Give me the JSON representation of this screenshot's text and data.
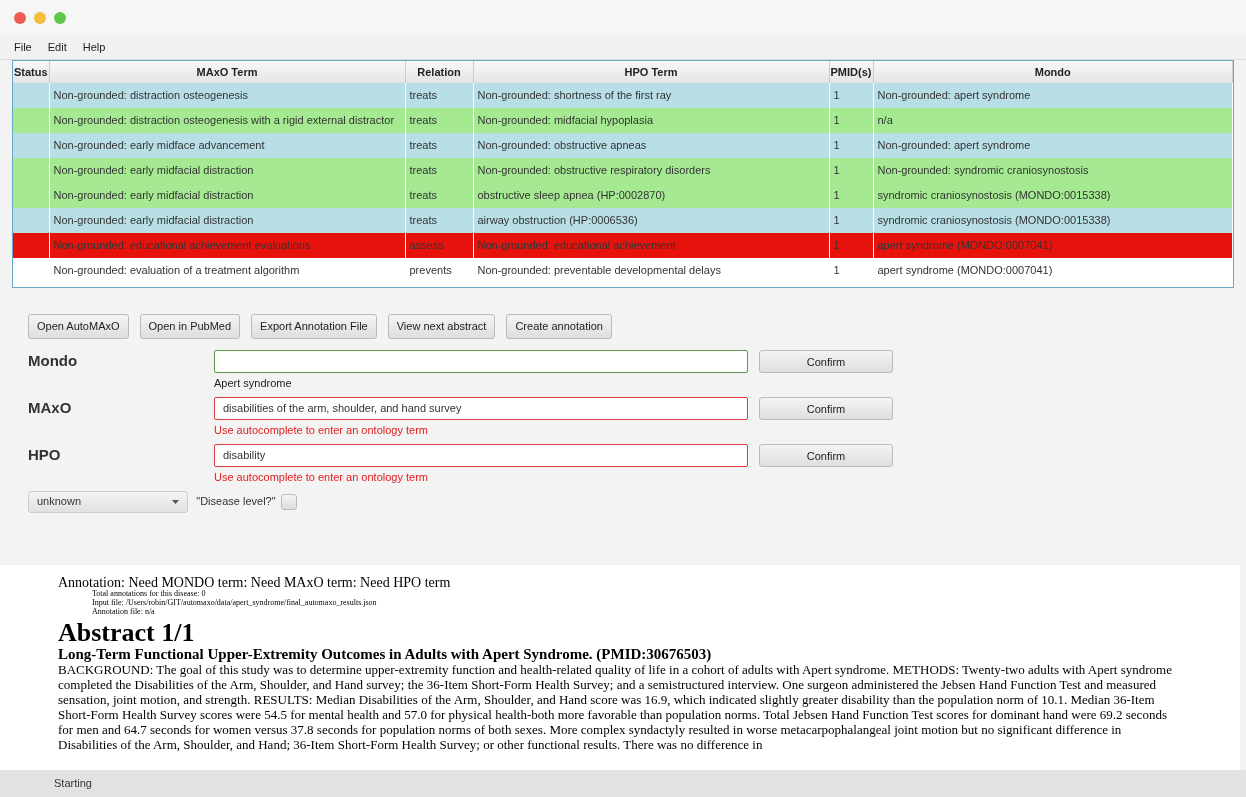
{
  "menu": [
    "File",
    "Edit",
    "Help"
  ],
  "table": {
    "columns": [
      "Status",
      "MAxO Term",
      "Relation",
      "HPO Term",
      "PMID(s)",
      "Mondo"
    ],
    "rows": [
      {
        "color": "#b9dfe6",
        "cells": [
          "",
          "Non-grounded: distraction osteogenesis",
          "treats",
          "Non-grounded: shortness of the first ray",
          "1",
          "Non-grounded: apert syndrome"
        ]
      },
      {
        "color": "#a5ea92",
        "cells": [
          "",
          "Non-grounded: distraction osteogenesis with a rigid external distractor",
          "treats",
          "Non-grounded: midfacial hypoplasia",
          "1",
          "n/a"
        ]
      },
      {
        "color": "#b9dfe6",
        "cells": [
          "",
          "Non-grounded: early midface advancement",
          "treats",
          "Non-grounded: obstructive apneas",
          "1",
          "Non-grounded: apert syndrome"
        ]
      },
      {
        "color": "#a5ea92",
        "cells": [
          "",
          "Non-grounded: early midfacial distraction",
          "treats",
          "Non-grounded: obstructive respiratory disorders",
          "1",
          "Non-grounded: syndromic craniosynostosis"
        ]
      },
      {
        "color": "#a5ea92",
        "cells": [
          "",
          "Non-grounded: early midfacial distraction",
          "treats",
          "obstructive sleep apnea (HP:0002870)",
          "1",
          "syndromic craniosynostosis (MONDO:0015338)"
        ]
      },
      {
        "color": "#b9dfe6",
        "cells": [
          "",
          "Non-grounded: early midfacial distraction",
          "treats",
          "airway obstruction (HP:0006536)",
          "1",
          "syndromic craniosynostosis (MONDO:0015338)"
        ]
      },
      {
        "color": "#e8120c",
        "cells": [
          "",
          "Non-grounded: educational achievement evaluations",
          "assess",
          "Non-grounded: educational achievement",
          "1",
          "apert syndrome (MONDO:0007041)"
        ]
      },
      {
        "color": "#ffffff",
        "cells": [
          "",
          "Non-grounded: evaluation of a treatment algorithm",
          "prevents",
          "Non-grounded: preventable developmental delays",
          "1",
          "apert syndrome (MONDO:0007041)"
        ]
      }
    ]
  },
  "buttons": [
    "Open AutoMAxO",
    "Open in PubMed",
    "Export Annotation File",
    "View next abstract",
    "Create annotation"
  ],
  "fields": [
    {
      "label": "Mondo",
      "valid": true,
      "hint": "Apert syndrome",
      "button": "Confirm"
    },
    {
      "label": "MAxO",
      "value": "disabilities of the arm, shoulder, and hand survey",
      "valid": false,
      "hint": "Use autocomplete to enter an ontology term",
      "button": "Confirm"
    },
    {
      "label": "HPO",
      "value": "disability",
      "valid": false,
      "hint": "Use autocomplete to enter an ontology term",
      "button": "Confirm"
    }
  ],
  "dropdown": {
    "value": "unknown"
  },
  "disease_level": {
    "label": "\"Disease level?\"",
    "checked": false
  },
  "abstract": {
    "annotation": "Annotation: Need MONDO term: Need MAxO term: Need HPO term",
    "info": [
      "Total annotations for this disease: 0",
      "Input file: /Users/robin/GIT/automaxo/data/apert_syndrome/final_automaxo_results.json",
      "Annotation file: n/a"
    ],
    "heading": "Abstract 1/1",
    "title": "Long-Term Functional Upper-Extremity Outcomes in Adults with Apert Syndrome. (PMID:30676503)",
    "text": "BACKGROUND: The goal of this study was to determine upper-extremity function and health-related quality of life in a cohort of adults with Apert syndrome. METHODS: Twenty-two adults with Apert syndrome completed the Disabilities of the Arm, Shoulder, and Hand survey; the 36-Item Short-Form Health Survey; and a semistructured interview. One surgeon administered the Jebsen Hand Function Test and measured sensation, joint motion, and strength. RESULTS: Median Disabilities of the Arm, Shoulder, and Hand score was 16.9, which indicated slightly greater disability than the population norm of 10.1. Median 36-Item Short-Form Health Survey scores were 54.5 for mental health and 57.0 for physical health-both more favorable than population norms. Total Jebsen Hand Function Test scores for dominant hand were 69.2 seconds for men and 64.7 seconds for women versus 37.8 seconds for population norms of both sexes. More complex syndactyly resulted in worse metacarpophalangeal joint motion but no significant difference in Disabilities of the Arm, Shoulder, and Hand; 36-Item Short-Form Health Survey; or other functional results. There was no difference in"
  },
  "status_bar": "Starting"
}
